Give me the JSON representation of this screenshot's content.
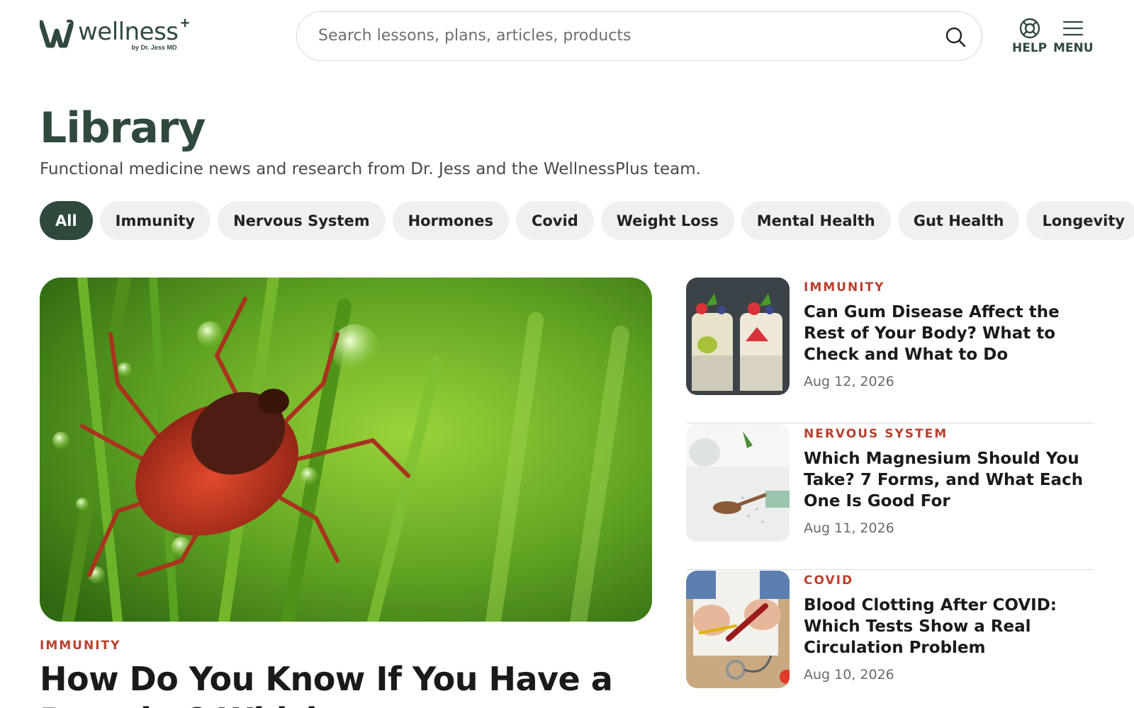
{
  "brand": {
    "name": "wellness",
    "plus": "+",
    "byline": "by Dr. Jess MD"
  },
  "search": {
    "placeholder": "Search lessons, plans, articles, products"
  },
  "header": {
    "help_label": "HELP",
    "menu_label": "MENU"
  },
  "page": {
    "title": "Library",
    "subtitle": "Functional medicine news and research from Dr. Jess and the WellnessPlus team."
  },
  "filters": [
    {
      "label": "All",
      "active": true
    },
    {
      "label": "Immunity"
    },
    {
      "label": "Nervous System"
    },
    {
      "label": "Hormones"
    },
    {
      "label": "Covid"
    },
    {
      "label": "Weight Loss"
    },
    {
      "label": "Mental Health"
    },
    {
      "label": "Gut Health"
    },
    {
      "label": "Longevity"
    }
  ],
  "featured": {
    "category": "IMMUNITY",
    "title": "How Do You Know If You Have a Parasite? Which"
  },
  "articles": [
    {
      "category": "IMMUNITY",
      "title": "Can Gum Disease Affect the Rest of Your Body? What to Check and What to Do",
      "date": "Aug 12, 2026"
    },
    {
      "category": "NERVOUS SYSTEM",
      "title": "Which Magnesium Should You Take? 7 Forms, and What Each One Is Good For",
      "date": "Aug 11, 2026"
    },
    {
      "category": "COVID",
      "title": "Blood Clotting After COVID: Which Tests Show a Real Circulation Problem",
      "date": "Aug 10, 2026"
    }
  ],
  "colors": {
    "brand": "#2f4a3c",
    "accent": "#b8402e",
    "chip_bg": "#f0f0ee"
  }
}
